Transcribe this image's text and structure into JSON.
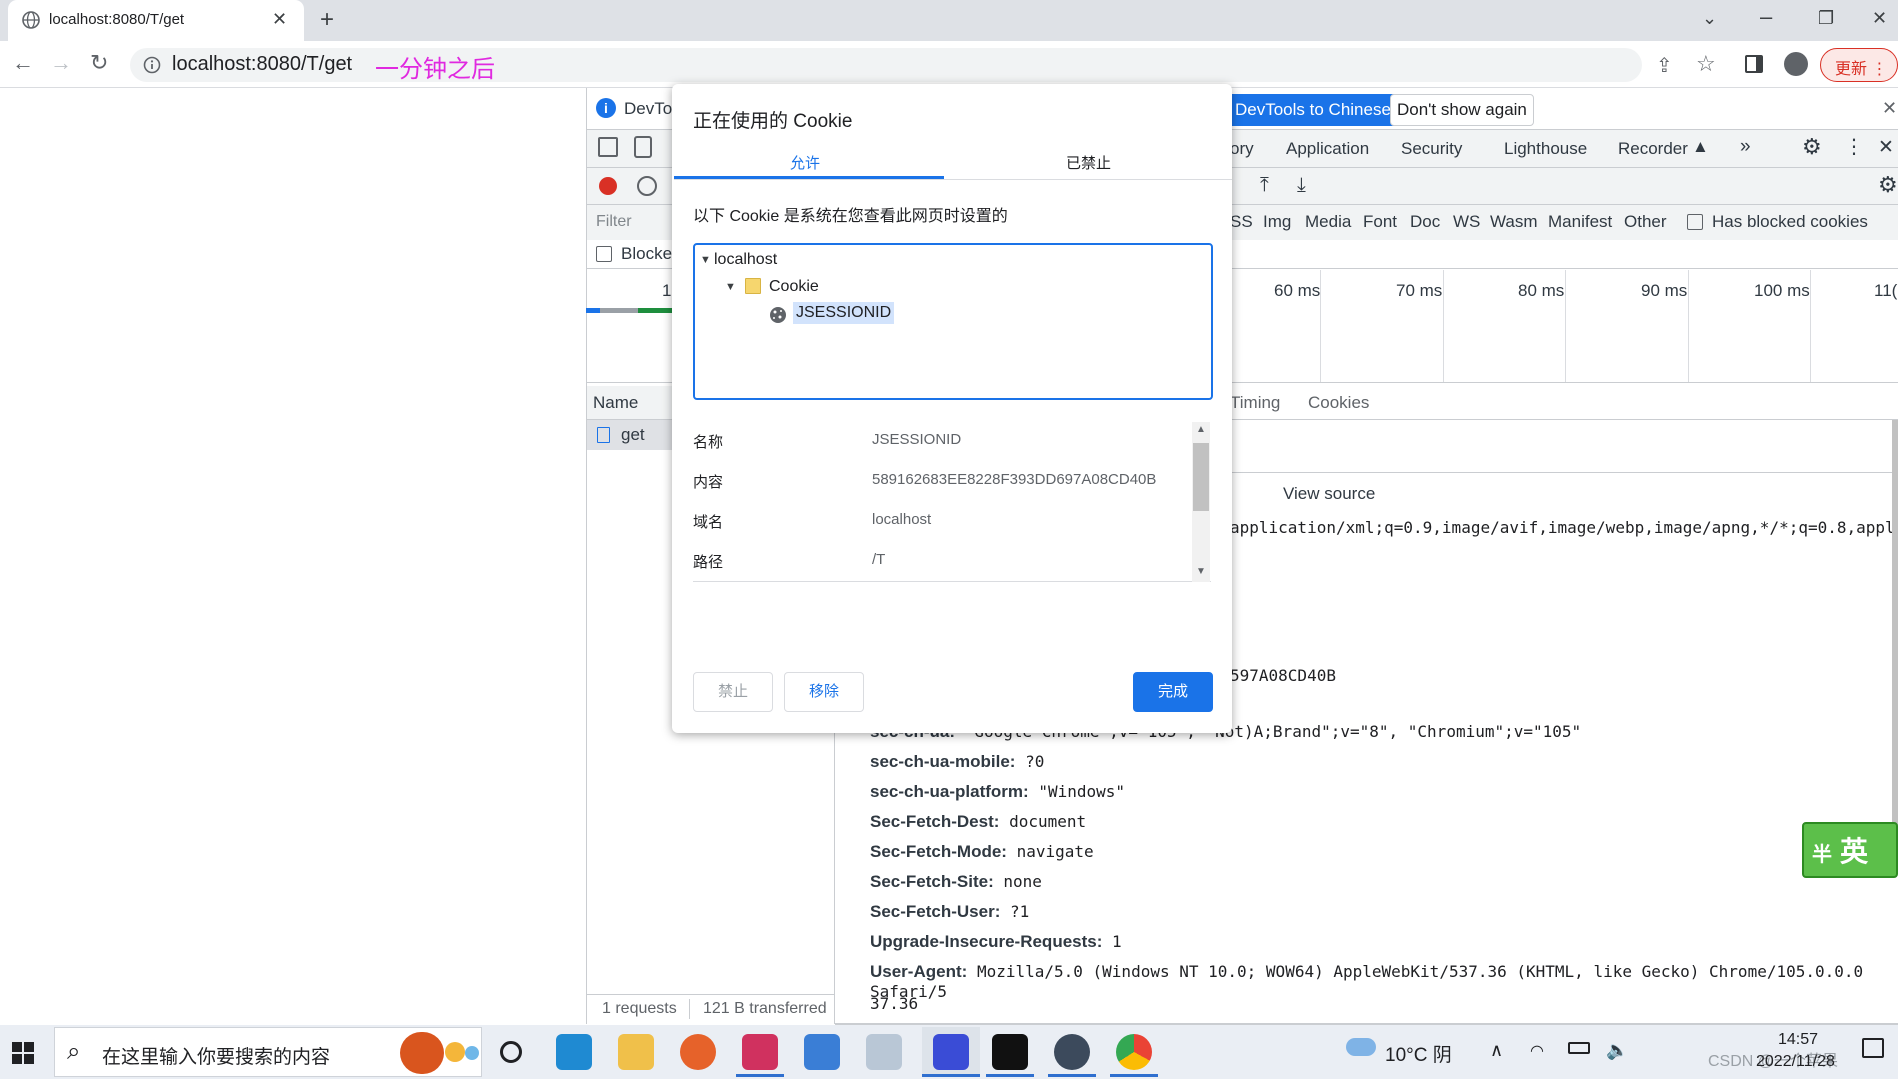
{
  "browser": {
    "tab_title": "localhost:8080/T/get",
    "url": "localhost:8080/T/get",
    "annotation": "一分钟之后",
    "update_label": "更新"
  },
  "devtools": {
    "info_text": "DevTo",
    "info_btn_chinese": "DevTools to Chinese",
    "info_btn_dismiss": "Don't show again",
    "panel_tabs": [
      "ory",
      "Application",
      "Security",
      "Lighthouse",
      "Recorder"
    ],
    "filter_placeholder": "Filter",
    "blocked_label": "Blocke",
    "type_filters": [
      "SS",
      "Img",
      "Media",
      "Font",
      "Doc",
      "WS",
      "Wasm",
      "Manifest",
      "Other"
    ],
    "has_blocked_cookies": "Has blocked cookies",
    "timeline_partial": "1(",
    "timeline_ticks": [
      "60 ms",
      "70 ms",
      "80 ms",
      "90 ms",
      "100 ms",
      "11("
    ],
    "name_header": "Name",
    "request_name": "get",
    "detail_tabs": [
      "Timing",
      "Cookies"
    ],
    "view_source": "View source",
    "accept_fragment": "application/xml;q=0.9,image/avif,image/webp,image/apng,*/*;q=0.8,applicat",
    "cookie_fragment": "597A08CD40B",
    "status_requests": "1 requests",
    "status_transferred": "121 B transferred",
    "headers": [
      {
        "name": "sec-ch-ua:",
        "value": "\"Google Chrome\";v=\"105\", \"Not)A;Brand\";v=\"8\", \"Chromium\";v=\"105\""
      },
      {
        "name": "sec-ch-ua-mobile:",
        "value": "?0"
      },
      {
        "name": "sec-ch-ua-platform:",
        "value": "\"Windows\""
      },
      {
        "name": "Sec-Fetch-Dest:",
        "value": "document"
      },
      {
        "name": "Sec-Fetch-Mode:",
        "value": "navigate"
      },
      {
        "name": "Sec-Fetch-Site:",
        "value": "none"
      },
      {
        "name": "Sec-Fetch-User:",
        "value": "?1"
      },
      {
        "name": "Upgrade-Insecure-Requests:",
        "value": "1"
      },
      {
        "name": "User-Agent:",
        "value": "Mozilla/5.0 (Windows NT 10.0; WOW64) AppleWebKit/537.36 (KHTML, like Gecko) Chrome/105.0.0.0 Safari/5"
      }
    ],
    "ua_wrap": "37.36"
  },
  "dialog": {
    "title": "正在使用的 Cookie",
    "tab_allowed": "允许",
    "tab_blocked": "已禁止",
    "description": "以下 Cookie 是系统在您查看此网页时设置的",
    "tree": {
      "site": "localhost",
      "folder": "Cookie",
      "cookie": "JSESSIONID"
    },
    "props": [
      {
        "label": "名称",
        "value": "JSESSIONID"
      },
      {
        "label": "内容",
        "value": "589162683EE8228F393DD697A08CD40B"
      },
      {
        "label": "域名",
        "value": "localhost"
      },
      {
        "label": "路径",
        "value": "/T"
      }
    ],
    "btn_block": "禁止",
    "btn_remove": "移除",
    "btn_done": "完成"
  },
  "taskbar": {
    "search_placeholder": "在这里输入你要搜索的内容",
    "weather": "10°C 阴",
    "time": "14:57",
    "date": "2022/11/28",
    "watermark": "CSDN @一个苹果",
    "ime_text": "英",
    "ime_mode": "半"
  }
}
